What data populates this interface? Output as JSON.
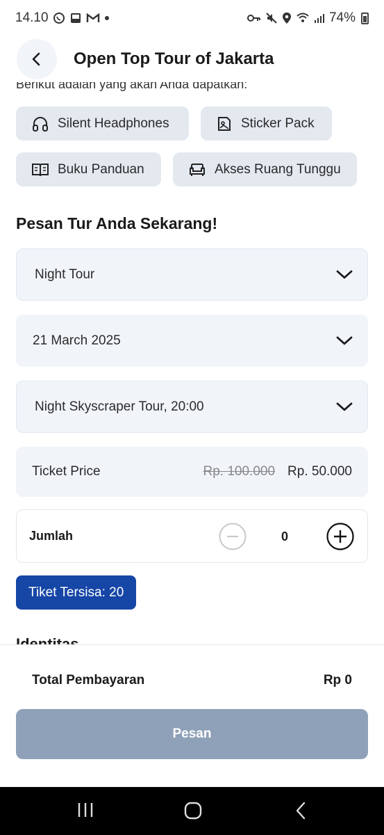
{
  "status_bar": {
    "time": "14.10",
    "battery": "74%"
  },
  "header": {
    "title": "Open Top Tour of Jakarta"
  },
  "intro": "Berikut adalah yang akan Anda dapatkan:",
  "benefits": [
    {
      "label": "Silent Headphones",
      "icon": "headphones-icon"
    },
    {
      "label": "Sticker Pack",
      "icon": "sticker-icon"
    },
    {
      "label": "Buku Panduan",
      "icon": "book-icon"
    },
    {
      "label": "Akses Ruang Tunggu",
      "icon": "sofa-icon"
    }
  ],
  "booking": {
    "section_title": "Pesan Tur Anda Sekarang!",
    "tour_type": "Night Tour",
    "date": "21 March 2025",
    "schedule": "Night Skyscraper Tour, 20:00",
    "ticket_price_label": "Ticket Price",
    "old_price": "Rp. 100.000",
    "new_price": "Rp. 50.000",
    "quantity_label": "Jumlah",
    "quantity": "0",
    "remaining_tickets": "Tiket Tersisa: 20",
    "next_section_peek": "Identitas"
  },
  "footer": {
    "total_label": "Total Pembayaran",
    "total_value": "Rp 0",
    "order_button": "Pesan"
  },
  "colors": {
    "accent": "#1646a6",
    "disabled_button": "#8fa1b8",
    "field_bg": "#f1f5fa",
    "chip_bg": "#e4e9f0"
  }
}
